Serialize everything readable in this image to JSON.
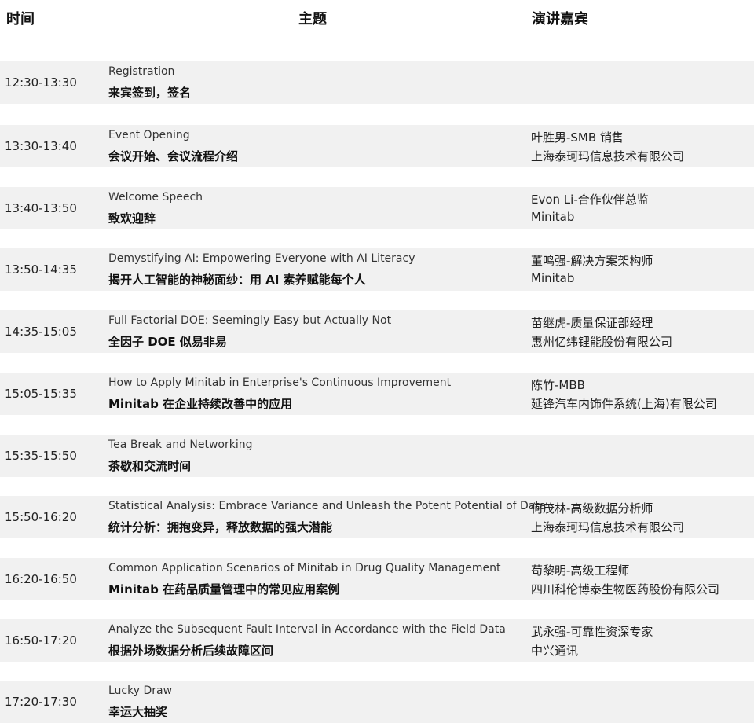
{
  "header": {
    "time": "时间",
    "topic": "主题",
    "speaker": "演讲嘉宾"
  },
  "rows": [
    {
      "time": "12:30-13:30",
      "en": "Registration",
      "cn": "来宾签到，签名",
      "speaker": "",
      "company": ""
    },
    {
      "time": "13:30-13:40",
      "en": "Event Opening",
      "cn": "会议开始、会议流程介绍",
      "speaker": "叶胜男-SMB 销售",
      "company": "上海泰珂玛信息技术有限公司"
    },
    {
      "time": "13:40-13:50",
      "en": "Welcome Speech",
      "cn": "致欢迎辞",
      "speaker": "Evon Li-合作伙伴总监",
      "company": "Minitab"
    },
    {
      "time": "13:50-14:35",
      "en": "Demystifying AI: Empowering Everyone with AI Literacy",
      "cn": "揭开人工智能的神秘面纱：用 AI 素养赋能每个人",
      "speaker": "董鸣强-解决方案架构师",
      "company": "Minitab"
    },
    {
      "time": "14:35-15:05",
      "en": "Full Factorial DOE: Seemingly Easy but Actually Not",
      "cn": "全因子 DOE  似易非易",
      "speaker": "苗继虎-质量保证部经理",
      "company": "惠州亿纬锂能股份有限公司"
    },
    {
      "time": "15:05-15:35",
      "en": "How to Apply Minitab in Enterprise's Continuous Improvement",
      "cn": "Minitab 在企业持续改善中的应用",
      "speaker": "陈竹-MBB",
      "company": "延锋汽车内饰件系统(上海)有限公司"
    },
    {
      "time": "15:35-15:50",
      "en": "Tea Break and Networking",
      "cn": "茶歇和交流时间",
      "speaker": "",
      "company": ""
    },
    {
      "time": "15:50-16:20",
      "en": "Statistical Analysis: Embrace Variance and Unleash the Potent Potential of Data",
      "cn": "统计分析：拥抱变异，释放数据的强大潜能",
      "speaker": "何茂林-高级数据分析师",
      "company": "上海泰珂玛信息技术有限公司"
    },
    {
      "time": "16:20-16:50",
      "en": "Common Application Scenarios of Minitab in Drug Quality Management",
      "cn": "Minitab 在药品质量管理中的常见应用案例",
      "speaker": "苟黎明-高级工程师",
      "company": "四川科伦博泰生物医药股份有限公司"
    },
    {
      "time": "16:50-17:20",
      "en": "Analyze the Subsequent Fault Interval in Accordance with the Field Data",
      "cn": "根据外场数据分析后续故障区间",
      "speaker": "武永强-可靠性资深专家",
      "company": "中兴通讯"
    },
    {
      "time": "17:20-17:30",
      "en": "Lucky Draw",
      "cn": "幸运大抽奖",
      "speaker": "",
      "company": ""
    }
  ]
}
